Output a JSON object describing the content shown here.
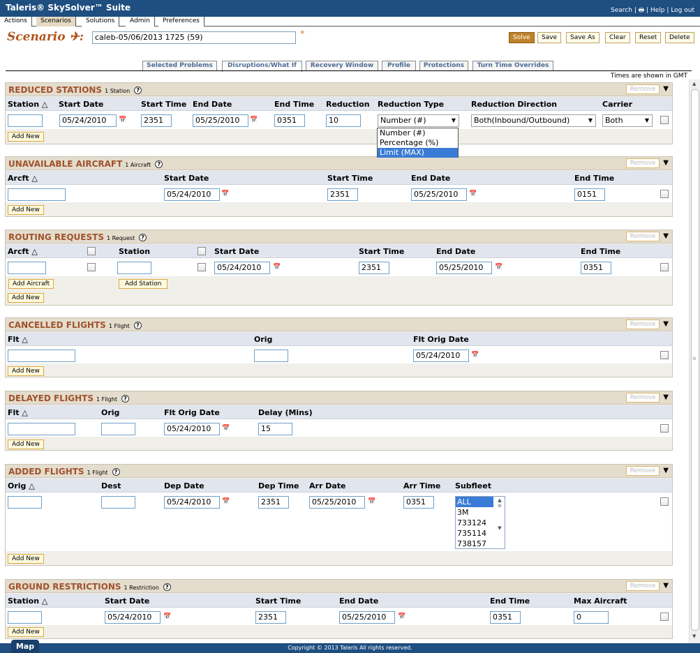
{
  "app": {
    "title": "Taleris® SkySolver™ Suite",
    "top_links": [
      "Search",
      "Help",
      "Log out"
    ]
  },
  "menu": [
    "Actions",
    "Scenarios",
    "Solutions",
    "Admin",
    "Preferences"
  ],
  "scenario": {
    "label": "Scenario",
    "name": "caleb-05/06/2013 1725 (59)",
    "required_mark": "*"
  },
  "toolbar": {
    "solve": "Solve",
    "save": "Save",
    "save_as": "Save As",
    "clear": "Clear",
    "reset": "Reset",
    "delete": "Delete"
  },
  "tabs": [
    "Selected Problems",
    "Disruptions/What If",
    "Recovery Window",
    "Profile",
    "Protections",
    "Turn Time Overrides"
  ],
  "times_note": "Times are shown in GMT",
  "common": {
    "remove": "Remove",
    "add_new": "Add New"
  },
  "reduced_stations": {
    "title": "REDUCED STATIONS",
    "count": "1 Station",
    "headers": [
      "Station",
      "Start Date",
      "Start Time",
      "End Date",
      "End Time",
      "Reduction",
      "Reduction Type",
      "Reduction Direction",
      "Carrier"
    ],
    "row": {
      "station": "",
      "start_date": "05/24/2010",
      "start_time": "2351",
      "end_date": "05/25/2010",
      "end_time": "0351",
      "reduction": "10",
      "reduction_type": "Number (#)",
      "direction": "Both(Inbound/Outbound)",
      "carrier": "Both"
    },
    "reduction_type_options": [
      "Number (#)",
      "Percentage (%)",
      "Limit (MAX)"
    ]
  },
  "unavailable_aircraft": {
    "title": "UNAVAILABLE AIRCRAFT",
    "count": "1 Aircraft",
    "headers": [
      "Arcft",
      "Start Date",
      "Start Time",
      "End Date",
      "End Time"
    ],
    "row": {
      "arcft": "",
      "start_date": "05/24/2010",
      "start_time": "2351",
      "end_date": "05/25/2010",
      "end_time": "0151"
    }
  },
  "routing_requests": {
    "title": "ROUTING REQUESTS",
    "count": "1 Request",
    "headers": [
      "Arcft",
      "Station",
      "Start Date",
      "Start Time",
      "End Date",
      "End Time"
    ],
    "row": {
      "arcft": "",
      "station": "",
      "start_date": "05/24/2010",
      "start_time": "2351",
      "end_date": "05/25/2010",
      "end_time": "0351"
    },
    "add_aircraft": "Add Aircraft",
    "add_station": "Add Station"
  },
  "cancelled_flights": {
    "title": "CANCELLED FLIGHTS",
    "count": "1 Flight",
    "headers": [
      "Flt",
      "Orig",
      "Flt Orig Date"
    ],
    "row": {
      "flt": "",
      "orig": "",
      "flt_orig_date": "05/24/2010"
    }
  },
  "delayed_flights": {
    "title": "DELAYED FLIGHTS",
    "count": "1 Flight",
    "headers": [
      "Flt",
      "Orig",
      "Flt Orig Date",
      "Delay (Mins)"
    ],
    "row": {
      "flt": "",
      "orig": "",
      "flt_orig_date": "05/24/2010",
      "delay": "15"
    }
  },
  "added_flights": {
    "title": "ADDED FLIGHTS",
    "count": "1 Flight",
    "headers": [
      "Orig",
      "Dest",
      "Dep Date",
      "Dep Time",
      "Arr Date",
      "Arr Time",
      "Subfleet"
    ],
    "row": {
      "orig": "",
      "dest": "",
      "dep_date": "05/24/2010",
      "dep_time": "2351",
      "arr_date": "05/25/2010",
      "arr_time": "0351"
    },
    "subfleet_options": [
      "ALL",
      "3M",
      "733124",
      "735114",
      "738157"
    ]
  },
  "ground_restrictions": {
    "title": "GROUND RESTRICTIONS",
    "count": "1 Restriction",
    "headers": [
      "Station",
      "Start Date",
      "Start Time",
      "End Date",
      "End Time",
      "Max Aircraft"
    ],
    "row": {
      "station": "",
      "start_date": "05/24/2010",
      "start_time": "2351",
      "end_date": "05/25/2010",
      "end_time": "0351",
      "max_aircraft": "0"
    }
  },
  "footer": {
    "copyright": "Copyright © 2013 Taleris All rights reserved.",
    "map": "Map"
  },
  "colors": {
    "header_blue": "#1f4e80",
    "panel_title": "#a0522d",
    "tab_text": "#4f6b95"
  }
}
